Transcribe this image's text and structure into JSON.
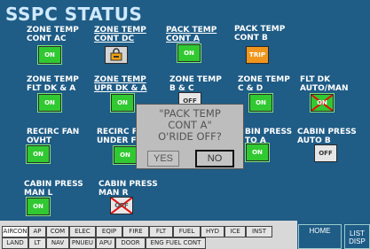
{
  "title": "SSPC STATUS",
  "cells": [
    {
      "label": "ZONE TEMP\nCONT AC",
      "state": "ON"
    },
    {
      "label": "ZONE TEMP\nCONT DC",
      "state": ""
    },
    {
      "label": "PACK TEMP\nCONT A",
      "state": "ON"
    },
    {
      "label": "PACK TEMP\nCONT B",
      "state": "TRIP"
    },
    {
      "label": "ZONE TEMP\nFLT DK & A",
      "state": "ON"
    },
    {
      "label": "ZONE TEMP\nUPR DK & A",
      "state": "ON"
    },
    {
      "label": "ZONE TEMP\nB & C",
      "state": "OFF"
    },
    {
      "label": "ZONE TEMP\nC & D",
      "state": "ON"
    },
    {
      "label": "FLT DK\nAUTO/MAN",
      "state": "ON"
    },
    {
      "label": "RECIRC FAN\nOVHT",
      "state": "ON"
    },
    {
      "label": "RECIRC FA\nUNDER FL",
      "state": "ON"
    },
    {
      "label": "BIN PRESS\nTO A",
      "state": "ON"
    },
    {
      "label": "CABIN PRESS\nAUTO B",
      "state": "OFF"
    },
    {
      "label": "CABIN PRESS\nMAN L",
      "state": "ON"
    },
    {
      "label": "CABIN PRESS\nMAN R",
      "state": "OFF"
    }
  ],
  "dialog": {
    "line1": "\"PACK TEMP",
    "line2": "CONT A\"",
    "line3": "O'RIDE OFF?",
    "yes": "YES",
    "no": "NO"
  },
  "tabs_row1": [
    "AIRCON",
    "AP",
    "COM",
    "ELEC",
    "EQIP",
    "FIRE",
    "FLT",
    "FUEL",
    "HYD",
    "ICE",
    "INST"
  ],
  "tabs_row2": [
    "LAND",
    "LT",
    "NAV",
    "PNUEU",
    "APU",
    "DOOR",
    "ENG FUEL CONT"
  ],
  "home": "HOME",
  "list_line1": "LIST",
  "list_line2": "DISP",
  "colors": {
    "background": "#1f5c86",
    "on": "#31c931",
    "trip": "#f0961e"
  }
}
